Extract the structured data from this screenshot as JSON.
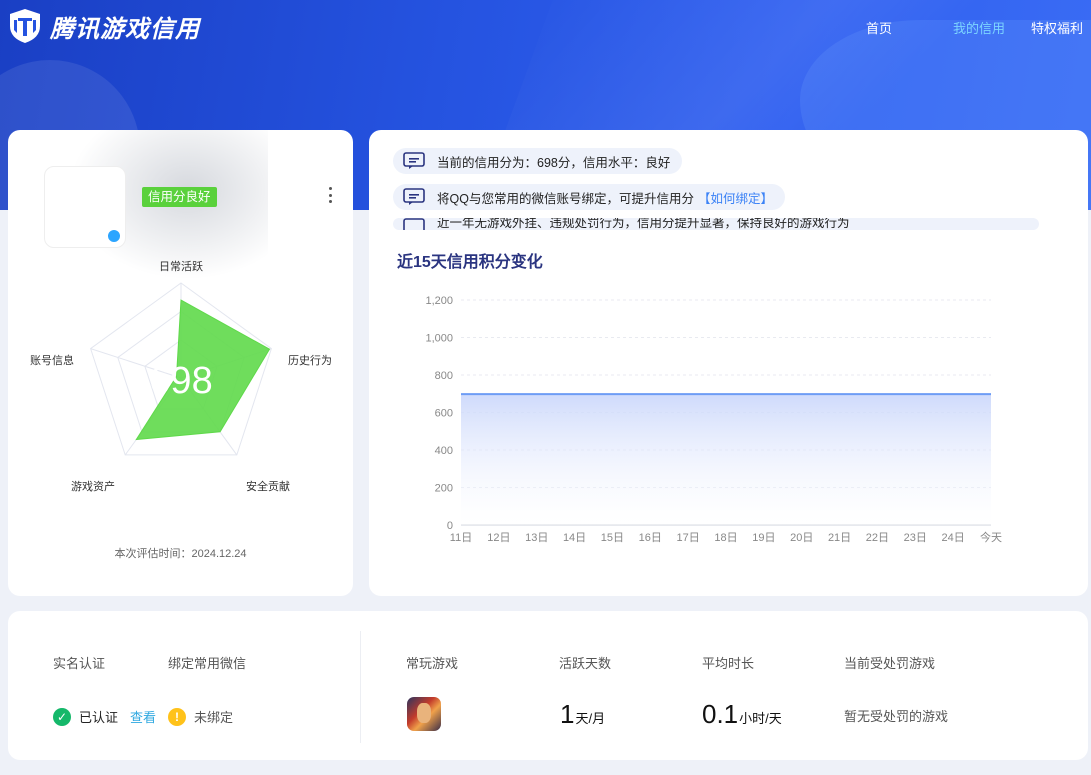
{
  "header": {
    "brand": "腾讯游戏信用",
    "nav": [
      {
        "label": "首页"
      },
      {
        "label": "我的信用"
      },
      {
        "label": "特权福利"
      }
    ]
  },
  "profile": {
    "credit_badge": "信用分良好",
    "score": "698",
    "radar_labels": {
      "daily": "日常活跃",
      "history": "历史行为",
      "security": "安全贡献",
      "assets": "游戏资产",
      "account": "账号信息"
    },
    "radar_values": [
      0.82,
      0.98,
      0.7,
      0.8,
      0.05
    ],
    "eval_time": "本次评估时间：2024.12.24"
  },
  "messages": {
    "msg1": "当前的信用分为：698分，信用水平：良好",
    "msg2": "将QQ与您常用的微信账号绑定，可提升信用分",
    "msg2_link": "【如何绑定】",
    "msg3": "近一年无游戏外挂、违规处罚行为，信用分提升显著，保持良好的游戏行为"
  },
  "chart_data": {
    "type": "area",
    "title": "近15天信用积分变化",
    "categories": [
      "11日",
      "12日",
      "13日",
      "14日",
      "15日",
      "16日",
      "17日",
      "18日",
      "19日",
      "20日",
      "21日",
      "22日",
      "23日",
      "24日",
      "今天"
    ],
    "series": [
      {
        "values": [
          698,
          698,
          698,
          698,
          698,
          698,
          698,
          698,
          698,
          698,
          698,
          698,
          698,
          698,
          698
        ]
      }
    ],
    "ylim": [
      0,
      1200
    ],
    "yticks": [
      "0",
      "200",
      "400",
      "600",
      "800",
      "1,000",
      "1,200"
    ],
    "grid": true,
    "line_color": "#6d9cf5"
  },
  "bottom": {
    "labels": {
      "realname": "实名认证",
      "wechat": "绑定常用微信",
      "game": "常玩游戏",
      "active_days": "活跃天数",
      "avg_time": "平均时长",
      "punish": "当前受处罚游戏"
    },
    "realname_status": "已认证",
    "view": "查看",
    "wechat_status": "未绑定",
    "active_days_value": "1",
    "active_days_unit": "天/月",
    "avg_time_value": "0.1",
    "avg_time_unit": "小时/天",
    "punish_value": "暂无受处罚的游戏"
  },
  "colors": {
    "brand_blue": "#2553e0",
    "badge_green": "#5ad13c",
    "radar_fill": "#5fd94a",
    "ok_green": "#15b86a",
    "warn_yellow": "#ffc21a"
  }
}
